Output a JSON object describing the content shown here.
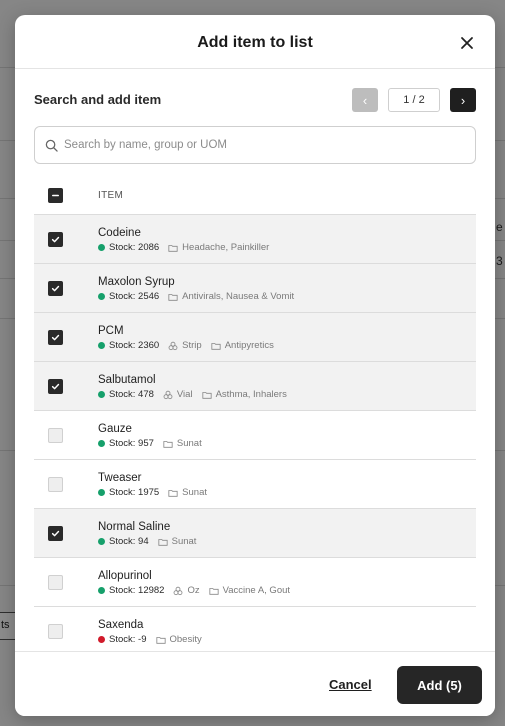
{
  "modal": {
    "title": "Add item to list",
    "section_title": "Search and add item",
    "pager": {
      "prev": "‹",
      "page_label": "1 / 2",
      "next": "›"
    },
    "search": {
      "placeholder": "Search by name, group or UOM",
      "value": ""
    },
    "table": {
      "column_item": "ITEM"
    },
    "items": [
      {
        "name": "Codeine",
        "stock": "Stock: 2086",
        "stock_status": "green",
        "uom": "",
        "groups": "Headache, Painkiller",
        "checked": true
      },
      {
        "name": "Maxolon Syrup",
        "stock": "Stock: 2546",
        "stock_status": "green",
        "uom": "",
        "groups": "Antivirals, Nausea & Vomit",
        "checked": true
      },
      {
        "name": "PCM",
        "stock": "Stock: 2360",
        "stock_status": "green",
        "uom": "Strip",
        "groups": "Antipyretics",
        "checked": true
      },
      {
        "name": "Salbutamol",
        "stock": "Stock: 478",
        "stock_status": "green",
        "uom": "Vial",
        "groups": "Asthma, Inhalers",
        "checked": true
      },
      {
        "name": "Gauze",
        "stock": "Stock: 957",
        "stock_status": "green",
        "uom": "",
        "groups": "Sunat",
        "checked": false
      },
      {
        "name": "Tweaser",
        "stock": "Stock: 1975",
        "stock_status": "green",
        "uom": "",
        "groups": "Sunat",
        "checked": false
      },
      {
        "name": "Normal Saline",
        "stock": "Stock: 94",
        "stock_status": "green",
        "uom": "",
        "groups": "Sunat",
        "checked": true
      },
      {
        "name": "Allopurinol",
        "stock": "Stock: 12982",
        "stock_status": "green",
        "uom": "Oz",
        "groups": "Vaccine A, Gout",
        "checked": false
      },
      {
        "name": "Saxenda",
        "stock": "Stock: -9",
        "stock_status": "red",
        "uom": "",
        "groups": "Obesity",
        "checked": false
      }
    ],
    "footer": {
      "cancel_label": "Cancel",
      "add_label": "Add (5)"
    }
  },
  "background": {
    "fragment_1": "e",
    "fragment_2": "3",
    "fragment_3": "ts"
  },
  "colors": {
    "accent_dark": "#262626",
    "stock_ok": "#16a06b",
    "stock_negative": "#d11a2a"
  },
  "icons": {
    "close": "close-icon",
    "search": "search-icon",
    "group": "folder-icon",
    "uom": "package-icon",
    "checkbox": "check-icon"
  }
}
